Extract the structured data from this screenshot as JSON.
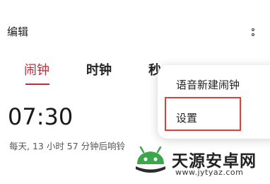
{
  "header": {
    "title": "编辑"
  },
  "tabs": [
    {
      "label": "闹钟",
      "active": true
    },
    {
      "label": "时钟",
      "active": false
    },
    {
      "label": "秒",
      "active": false
    }
  ],
  "alarm": {
    "time": "07:30",
    "description": "每天, 13 小时 57 分钟后响铃"
  },
  "menu": {
    "items": [
      {
        "label": "语音新建闹钟"
      },
      {
        "label": "设置",
        "highlighted": true
      }
    ]
  },
  "watermark": {
    "name": "天源安卓网",
    "url": "www.jytyaz.com"
  },
  "colors": {
    "accent": "#b8303e",
    "highlight_border": "#d8433a",
    "logo_green": "#3aa84a"
  }
}
